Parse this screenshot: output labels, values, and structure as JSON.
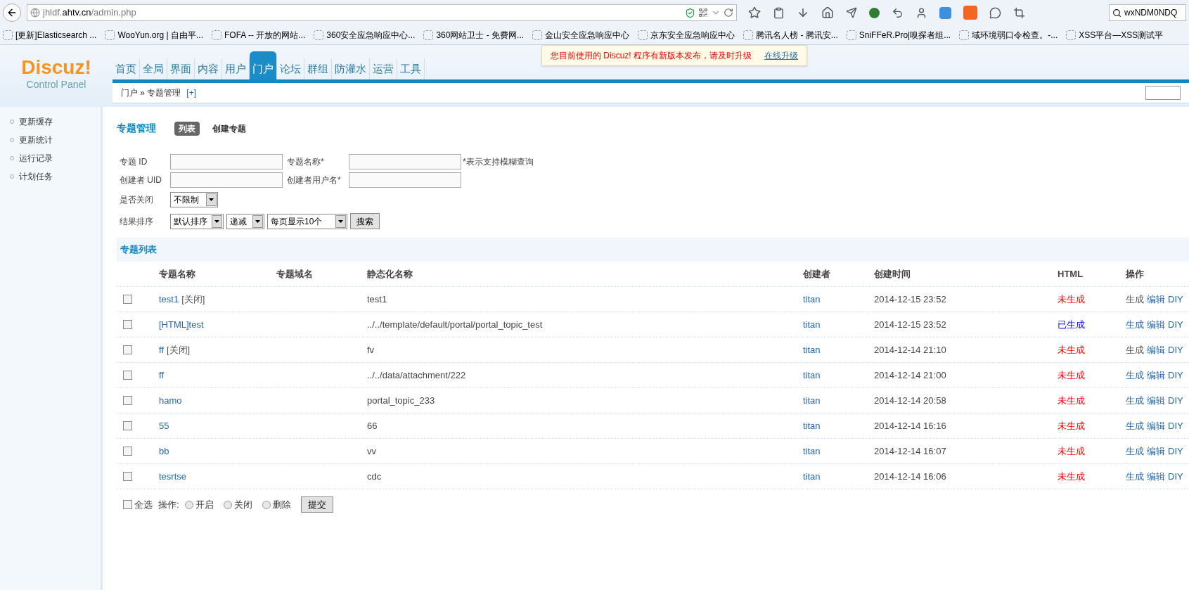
{
  "browser": {
    "url_host": "jhldf.",
    "url_domain": "ahtv.cn",
    "url_path": "/admin.php",
    "search_value": "wxNDM0NDQ",
    "bookmarks": [
      "[更新]Elasticsearch ...",
      "WooYun.org | 自由平...",
      "FOFA -- 开放的网站...",
      "360安全应急响应中心...",
      "360网站卫士 - 免费网...",
      "金山安全应急响应中心",
      "京东安全应急响应中心",
      "腾讯名人榜 - 腾讯安...",
      "SniFFeR.Pro|嗅探者组...",
      "域环境弱口令检查。-...",
      "XSS平台—XSS测试平"
    ]
  },
  "header": {
    "logo": "Discuz!",
    "logo_sub": "Control Panel",
    "nav": [
      {
        "label": "首页",
        "selected": false
      },
      {
        "label": "全局",
        "selected": false
      },
      {
        "label": "界面",
        "selected": false
      },
      {
        "label": "内容",
        "selected": false
      },
      {
        "label": "用户",
        "selected": false
      },
      {
        "label": "门户",
        "selected": true
      },
      {
        "label": "论坛",
        "selected": false
      },
      {
        "label": "群组",
        "selected": false
      },
      {
        "label": "防灌水",
        "selected": false
      },
      {
        "label": "运营",
        "selected": false
      },
      {
        "label": "工具",
        "selected": false
      }
    ],
    "notice": "您目前使用的 Discuz! 程序有新版本发布，请及时升级",
    "notice_link": "在线升级",
    "breadcrumb": "门户 » 专题管理",
    "breadcrumb_add": "[+]"
  },
  "sidebar": {
    "items": [
      "更新缓存",
      "更新统计",
      "运行记录",
      "计划任务"
    ]
  },
  "page": {
    "title": "专题管理",
    "tabs": [
      {
        "label": "列表",
        "selected": true
      },
      {
        "label": "创建专题",
        "selected": false
      }
    ]
  },
  "filters": {
    "topic_id": "专题 ID",
    "topic_name": "专题名称*",
    "fuzzy_hint": "*表示支持模糊查询",
    "creator_uid": "创建者 UID",
    "creator_name": "创建者用户名*",
    "closed_label": "是否关闭",
    "closed_value": "不限制",
    "sort_label": "结果排序",
    "sort_value": "默认排序",
    "order_value": "递减",
    "per_page_value": "每页显示10个",
    "search_button": "搜索"
  },
  "table": {
    "title": "专题列表",
    "columns": [
      "专题名称",
      "专题域名",
      "静态化名称",
      "创建者",
      "创建时间",
      "HTML",
      "操作"
    ],
    "rows": [
      {
        "name": "test1",
        "tag": "[关闭]",
        "static": "test1",
        "creator": "titan",
        "time": "2014-12-15 23:52",
        "html": "未生成",
        "html_done": false,
        "checked": false,
        "actions": [
          {
            "label": "生成",
            "disabled": true
          },
          {
            "label": "编辑",
            "disabled": false
          },
          {
            "label": "DIY",
            "disabled": false
          }
        ]
      },
      {
        "name": "[HTML]test",
        "static": "../../template/default/portal/portal_topic_test",
        "creator": "titan",
        "time": "2014-12-15 23:52",
        "html": "已生成",
        "html_done": true,
        "checked": false,
        "actions": [
          {
            "label": "生成",
            "disabled": false
          },
          {
            "label": "编辑",
            "disabled": false
          },
          {
            "label": "DIY",
            "disabled": false
          }
        ]
      },
      {
        "name": "ff",
        "tag": "[关闭]",
        "static": "fv",
        "creator": "titan",
        "time": "2014-12-14 21:10",
        "html": "未生成",
        "html_done": false,
        "checked": false,
        "actions": [
          {
            "label": "生成",
            "disabled": true
          },
          {
            "label": "编辑",
            "disabled": false
          },
          {
            "label": "DIY",
            "disabled": false
          }
        ]
      },
      {
        "name": "ff",
        "static": "../../data/attachment/222",
        "creator": "titan",
        "time": "2014-12-14 21:00",
        "html": "未生成",
        "html_done": false,
        "checked": false,
        "actions": [
          {
            "label": "生成",
            "disabled": false
          },
          {
            "label": "编辑",
            "disabled": false
          },
          {
            "label": "DIY",
            "disabled": false
          }
        ]
      },
      {
        "name": "hamo",
        "static": "portal_topic_233",
        "creator": "titan",
        "time": "2014-12-14 20:58",
        "html": "未生成",
        "html_done": false,
        "checked": false,
        "actions": [
          {
            "label": "生成",
            "disabled": false
          },
          {
            "label": "编辑",
            "disabled": false
          },
          {
            "label": "DIY",
            "disabled": false
          }
        ]
      },
      {
        "name": "55",
        "static": "66",
        "creator": "titan",
        "time": "2014-12-14 16:16",
        "html": "未生成",
        "html_done": false,
        "checked": false,
        "actions": [
          {
            "label": "生成",
            "disabled": false
          },
          {
            "label": "编辑",
            "disabled": false
          },
          {
            "label": "DIY",
            "disabled": false
          }
        ]
      },
      {
        "name": "bb",
        "static": "vv",
        "creator": "titan",
        "time": "2014-12-14 16:07",
        "html": "未生成",
        "html_done": false,
        "checked": false,
        "actions": [
          {
            "label": "生成",
            "disabled": false
          },
          {
            "label": "编辑",
            "disabled": false
          },
          {
            "label": "DIY",
            "disabled": false
          }
        ]
      },
      {
        "name": "tesrtse",
        "static": "cdc",
        "creator": "titan",
        "time": "2014-12-14 16:06",
        "html": "未生成",
        "html_done": false,
        "checked": false,
        "actions": [
          {
            "label": "生成",
            "disabled": false
          },
          {
            "label": "编辑",
            "disabled": false
          },
          {
            "label": "DIY",
            "disabled": false
          }
        ]
      }
    ],
    "footer": {
      "select_all": "全选",
      "select_all_checked": false,
      "op_label": "操作:",
      "options": [
        {
          "label": "开启",
          "selected": false
        },
        {
          "label": "关闭",
          "selected": false
        },
        {
          "label": "删除",
          "selected": false
        }
      ],
      "submit": "提交"
    }
  }
}
